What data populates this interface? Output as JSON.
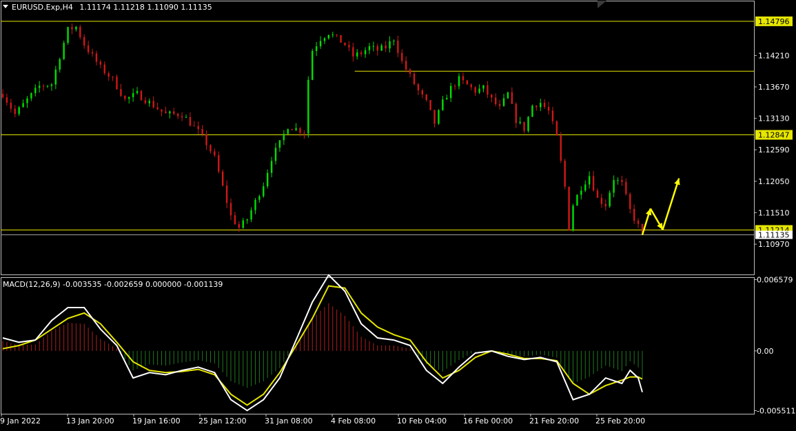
{
  "header": {
    "symbol": "EURUSD.Exp,H4",
    "ohlc": "1.11174 1.11218 1.11090 1.11135",
    "macd_label": "MACD(12,26,9) -0.003535 -0.002659 0.000000 -0.001139"
  },
  "colors": {
    "background": "#000000",
    "bull": "#00e000",
    "bear": "#d01818",
    "level": "#e6e600",
    "macd_line": "#ffffff",
    "signal_line": "#e6e600",
    "arrow": "#ffff00",
    "hist_pos": "#b02020",
    "hist_neg": "#1f7a1f"
  },
  "chart_data": [
    {
      "type": "candlestick",
      "symbol": "EURUSD.Exp",
      "timeframe": "H4",
      "y_ticks": [
        "1.14210",
        "1.13670",
        "1.13130",
        "1.12590",
        "1.12050",
        "1.11510",
        "1.10970"
      ],
      "ylim": [
        1.1045,
        1.1515
      ],
      "horizontal_levels": [
        {
          "value": 1.14796,
          "label": "1.14796",
          "from": 0.0
        },
        {
          "value": 1.1394,
          "label": "",
          "from": 0.47
        },
        {
          "value": 1.12847,
          "label": "1.12847",
          "from": 0.0
        },
        {
          "value": 1.11214,
          "label": "1.11214",
          "from": 0.0
        }
      ],
      "current_price_label": "1.11135",
      "x_ticks": [
        "9 Jan 2022",
        "13 Jan 20:00",
        "19 Jan 16:00",
        "25 Jan 12:00",
        "31 Jan 08:00",
        "4 Feb 08:00",
        "10 Feb 04:00",
        "16 Feb 00:00",
        "21 Feb 20:00",
        "25 Feb 20:00"
      ],
      "close_path": [
        [
          0,
          1.1355
        ],
        [
          3,
          1.132
        ],
        [
          6,
          1.1345
        ],
        [
          9,
          1.1368
        ],
        [
          12,
          1.1372
        ],
        [
          14,
          1.142
        ],
        [
          16,
          1.1465
        ],
        [
          18,
          1.147
        ],
        [
          20,
          1.144
        ],
        [
          22,
          1.142
        ],
        [
          24,
          1.14
        ],
        [
          27,
          1.138
        ],
        [
          30,
          1.1345
        ],
        [
          33,
          1.1355
        ],
        [
          36,
          1.134
        ],
        [
          40,
          1.132
        ],
        [
          44,
          1.132
        ],
        [
          48,
          1.129
        ],
        [
          50,
          1.127
        ],
        [
          52,
          1.1245
        ],
        [
          54,
          1.1195
        ],
        [
          56,
          1.1145
        ],
        [
          58,
          1.1125
        ],
        [
          60,
          1.114
        ],
        [
          62,
          1.117
        ],
        [
          64,
          1.12
        ],
        [
          66,
          1.1245
        ],
        [
          68,
          1.127
        ],
        [
          70,
          1.13
        ],
        [
          72,
          1.1295
        ],
        [
          74,
          1.129
        ],
        [
          75,
          1.138
        ],
        [
          76,
          1.143
        ],
        [
          78,
          1.145
        ],
        [
          80,
          1.146
        ],
        [
          82,
          1.145
        ],
        [
          84,
          1.144
        ],
        [
          86,
          1.142
        ],
        [
          88,
          1.1425
        ],
        [
          90,
          1.1435
        ],
        [
          92,
          1.143
        ],
        [
          94,
          1.1435
        ],
        [
          96,
          1.145
        ],
        [
          98,
          1.141
        ],
        [
          100,
          1.1385
        ],
        [
          102,
          1.136
        ],
        [
          104,
          1.134
        ],
        [
          106,
          1.1305
        ],
        [
          108,
          1.134
        ],
        [
          110,
          1.1365
        ],
        [
          112,
          1.138
        ],
        [
          114,
          1.137
        ],
        [
          116,
          1.136
        ],
        [
          118,
          1.1365
        ],
        [
          120,
          1.1345
        ],
        [
          122,
          1.133
        ],
        [
          124,
          1.1355
        ],
        [
          126,
          1.131
        ],
        [
          128,
          1.1295
        ],
        [
          130,
          1.1335
        ],
        [
          132,
          1.134
        ],
        [
          134,
          1.1325
        ],
        [
          136,
          1.128
        ],
        [
          138,
          1.1195
        ],
        [
          139,
          1.1125
        ],
        [
          140,
          1.1165
        ],
        [
          142,
          1.1195
        ],
        [
          144,
          1.1215
        ],
        [
          146,
          1.1175
        ],
        [
          148,
          1.1165
        ],
        [
          150,
          1.121
        ],
        [
          152,
          1.12
        ],
        [
          154,
          1.1155
        ],
        [
          156,
          1.1128
        ],
        [
          157,
          1.1113
        ]
      ],
      "projection": [
        [
          157,
          1.1113
        ],
        [
          159,
          1.1158
        ],
        [
          162,
          1.1122
        ],
        [
          166,
          1.121
        ]
      ]
    },
    {
      "type": "line",
      "title": "MACD(12,26,9)",
      "y_ticks": [
        "0.006579",
        "0.00",
        "-0.005511"
      ],
      "ylim": [
        -0.0058,
        0.0068
      ],
      "macd": [
        [
          0,
          0.0012
        ],
        [
          4,
          0.0008
        ],
        [
          8,
          0.001
        ],
        [
          12,
          0.0028
        ],
        [
          16,
          0.004
        ],
        [
          20,
          0.004
        ],
        [
          24,
          0.002
        ],
        [
          28,
          0.0005
        ],
        [
          32,
          -0.0025
        ],
        [
          36,
          -0.002
        ],
        [
          40,
          -0.0022
        ],
        [
          44,
          -0.0018
        ],
        [
          48,
          -0.0015
        ],
        [
          52,
          -0.002
        ],
        [
          56,
          -0.0045
        ],
        [
          60,
          -0.0055
        ],
        [
          64,
          -0.0045
        ],
        [
          68,
          -0.0025
        ],
        [
          72,
          0.001
        ],
        [
          76,
          0.0045
        ],
        [
          80,
          0.007
        ],
        [
          84,
          0.0055
        ],
        [
          88,
          0.0025
        ],
        [
          92,
          0.0012
        ],
        [
          96,
          0.001
        ],
        [
          100,
          0.0005
        ],
        [
          104,
          -0.0018
        ],
        [
          108,
          -0.003
        ],
        [
          112,
          -0.0015
        ],
        [
          116,
          -0.0002
        ],
        [
          120,
          0.0
        ],
        [
          124,
          -0.0005
        ],
        [
          128,
          -0.0008
        ],
        [
          132,
          -0.0006
        ],
        [
          136,
          -0.001
        ],
        [
          140,
          -0.0045
        ],
        [
          144,
          -0.004
        ],
        [
          148,
          -0.0025
        ],
        [
          152,
          -0.003
        ],
        [
          154,
          -0.0018
        ],
        [
          156,
          -0.0025
        ],
        [
          157,
          -0.0038
        ]
      ],
      "signal": [
        [
          0,
          0.0002
        ],
        [
          4,
          0.0005
        ],
        [
          8,
          0.001
        ],
        [
          12,
          0.002
        ],
        [
          16,
          0.003
        ],
        [
          20,
          0.0035
        ],
        [
          24,
          0.0025
        ],
        [
          28,
          0.0008
        ],
        [
          32,
          -0.001
        ],
        [
          36,
          -0.0018
        ],
        [
          40,
          -0.002
        ],
        [
          44,
          -0.0019
        ],
        [
          48,
          -0.0017
        ],
        [
          52,
          -0.0022
        ],
        [
          56,
          -0.004
        ],
        [
          60,
          -0.005
        ],
        [
          64,
          -0.004
        ],
        [
          68,
          -0.002
        ],
        [
          72,
          0.0005
        ],
        [
          76,
          0.003
        ],
        [
          80,
          0.006
        ],
        [
          84,
          0.0058
        ],
        [
          88,
          0.0035
        ],
        [
          92,
          0.0022
        ],
        [
          96,
          0.0015
        ],
        [
          100,
          0.001
        ],
        [
          104,
          -0.001
        ],
        [
          108,
          -0.0025
        ],
        [
          112,
          -0.0018
        ],
        [
          116,
          -0.0006
        ],
        [
          120,
          0.0
        ],
        [
          124,
          -0.0003
        ],
        [
          128,
          -0.0007
        ],
        [
          132,
          -0.0007
        ],
        [
          136,
          -0.0009
        ],
        [
          140,
          -0.003
        ],
        [
          144,
          -0.004
        ],
        [
          148,
          -0.0032
        ],
        [
          152,
          -0.0027
        ],
        [
          154,
          -0.0024
        ],
        [
          156,
          -0.0024
        ],
        [
          157,
          -0.0026
        ]
      ]
    }
  ]
}
